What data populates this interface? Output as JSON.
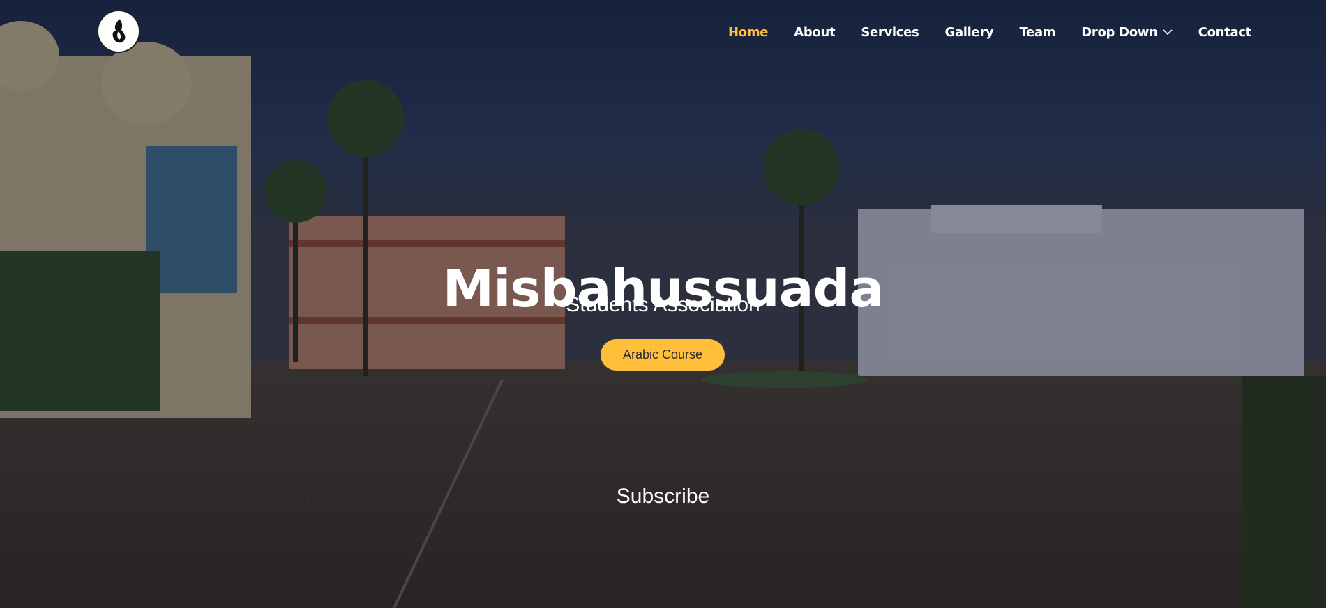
{
  "header": {
    "logo_name": "flame-logo-icon"
  },
  "nav": {
    "items": [
      {
        "label": "Home",
        "active": true
      },
      {
        "label": "About"
      },
      {
        "label": "Services"
      },
      {
        "label": "Gallery"
      },
      {
        "label": "Team"
      },
      {
        "label": "Drop Down",
        "has_dropdown": true
      },
      {
        "label": "Contact"
      }
    ]
  },
  "hero": {
    "title": "Misbahussuada",
    "subtitle": "Students Association",
    "cta_label": "Arabic Course",
    "watermark_text": "salsabeel_paravur_",
    "subscribe_label": "Subscribe"
  },
  "colors": {
    "accent": "#ffc03a",
    "nav_text": "#ffffff"
  }
}
